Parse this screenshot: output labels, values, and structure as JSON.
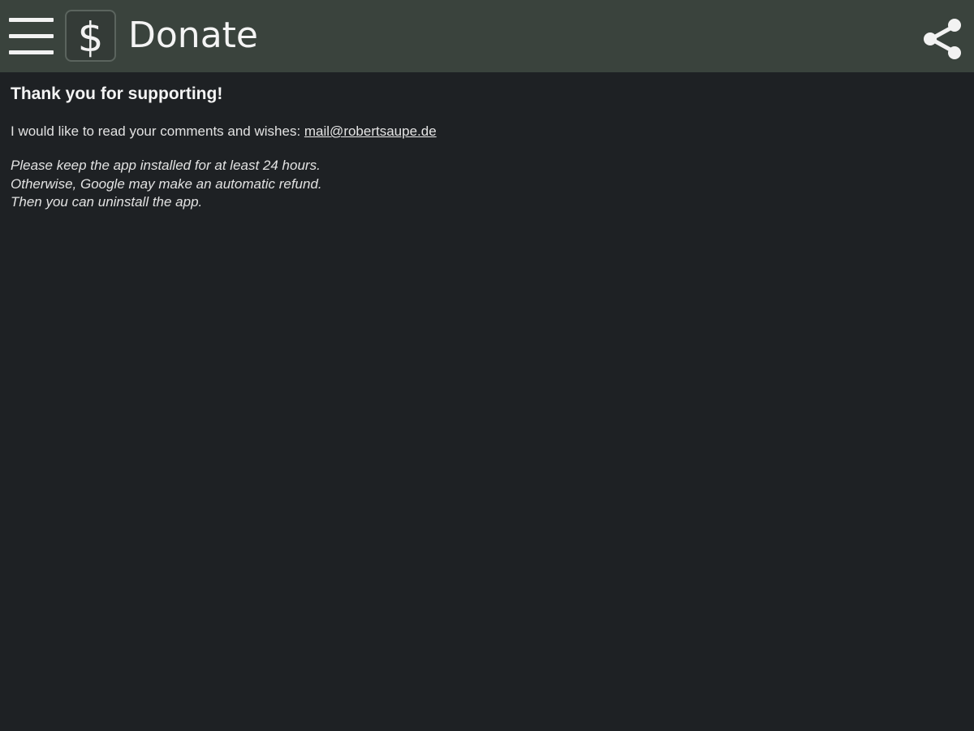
{
  "appbar": {
    "menu_icon": "hamburger-menu-icon",
    "logo_icon": "dollar-sign-icon",
    "logo_glyph": "$",
    "title": "Donate",
    "share_icon": "share-icon",
    "background_color": "#3a433d"
  },
  "content": {
    "heading": "Thank you for supporting!",
    "contact_text": "I would like to read your comments and wishes: ",
    "contact_email": "mail@robertsaupe.de",
    "note_lines": [
      "Please keep the app installed for at least 24 hours.",
      "Otherwise, Google may make an automatic refund.",
      "Then you can uninstall the app."
    ]
  },
  "colors": {
    "background": "#1e2124",
    "text": "#e8e8e8"
  }
}
